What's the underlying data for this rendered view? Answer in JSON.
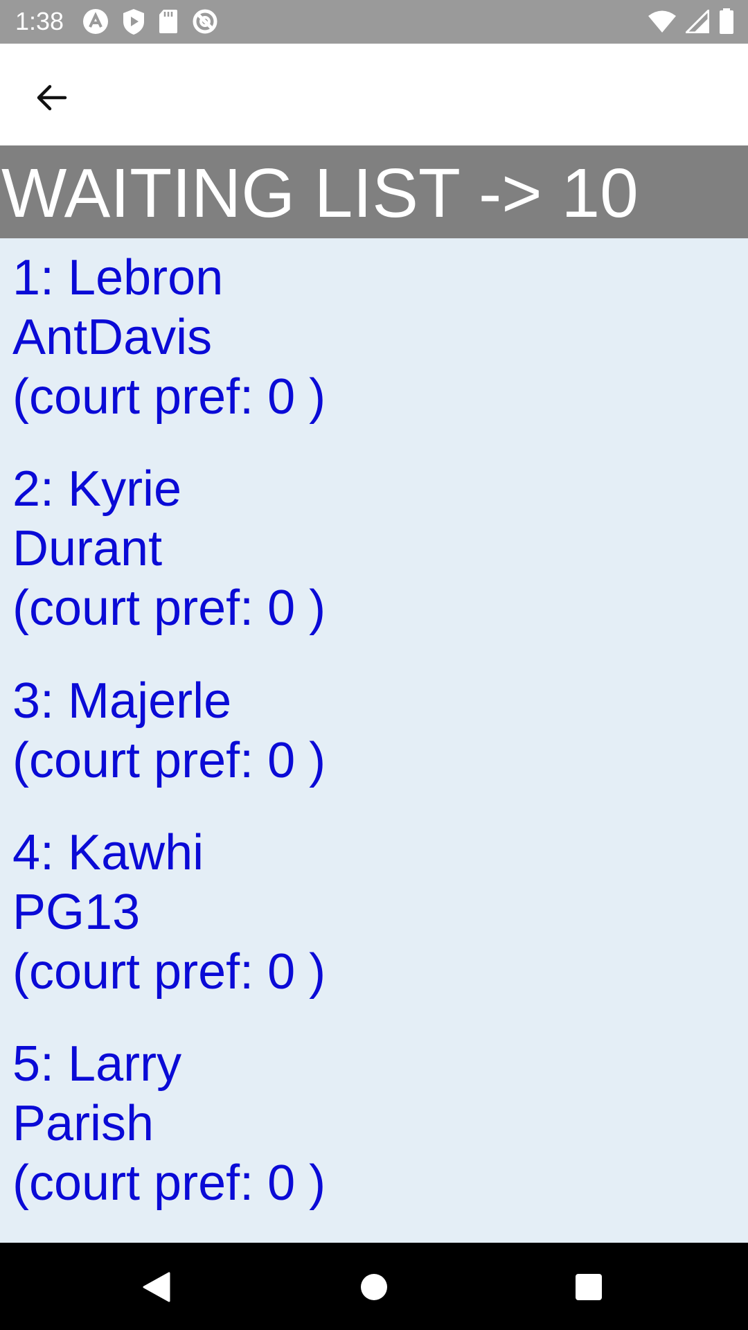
{
  "status_bar": {
    "time": "1:38",
    "left_icons": [
      "a-circle-icon",
      "shield-play-icon",
      "sd-card-icon",
      "no-sync-icon"
    ],
    "right_icons": [
      "wifi-icon",
      "cell-signal-icon",
      "battery-icon"
    ]
  },
  "app_bar": {
    "back_icon": "arrow-left-icon"
  },
  "header": {
    "title": "WAITING LIST -> 10"
  },
  "waiting_list": [
    {
      "lines": [
        "1: Lebron",
        "AntDavis",
        "(court pref: 0 )"
      ]
    },
    {
      "lines": [
        "2: Kyrie",
        "Durant",
        "(court pref: 0 )"
      ]
    },
    {
      "lines": [
        "3: Majerle",
        "(court pref: 0 )"
      ]
    },
    {
      "lines": [
        "4: Kawhi",
        "PG13",
        "(court pref: 0 )"
      ]
    },
    {
      "lines": [
        "5: Larry",
        "Parish",
        "(court pref: 0 )"
      ]
    }
  ],
  "nav_bar": {
    "buttons": [
      "back-triangle-icon",
      "home-circle-icon",
      "recents-square-icon"
    ]
  },
  "colors": {
    "status_bar": "#9a9a9a",
    "header_banner": "#808080",
    "list_background": "#e4eef6",
    "list_text": "#0a0ad6",
    "nav_bar": "#000000"
  }
}
